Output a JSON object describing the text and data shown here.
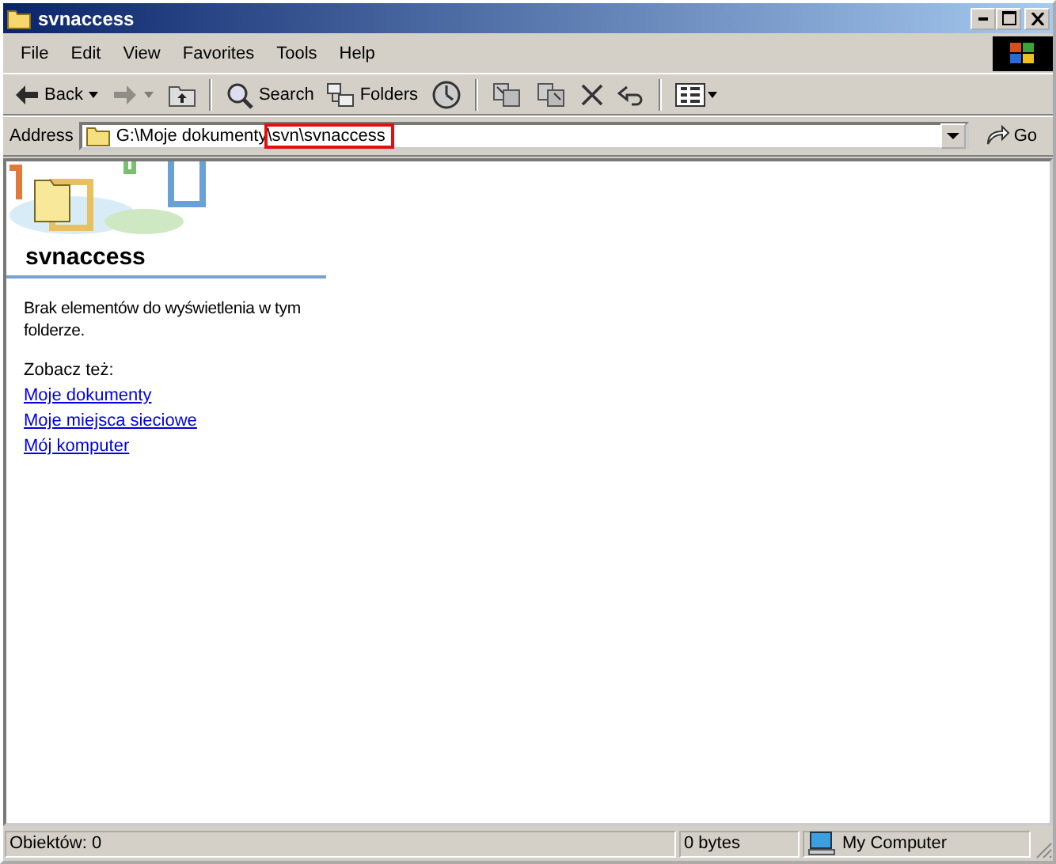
{
  "window": {
    "title": "svnaccess"
  },
  "menu": [
    "File",
    "Edit",
    "View",
    "Favorites",
    "Tools",
    "Help"
  ],
  "toolbar": [
    {
      "kind": "back",
      "label": "Back",
      "disabled": false
    },
    {
      "kind": "forward",
      "disabled": true
    },
    {
      "kind": "up",
      "disabled": false
    },
    {
      "kind": "separator"
    },
    {
      "kind": "search",
      "label": "Search",
      "disabled": false
    },
    {
      "kind": "folders",
      "label": "Folders",
      "disabled": false
    },
    {
      "kind": "history",
      "disabled": false
    },
    {
      "kind": "separator"
    },
    {
      "kind": "move",
      "disabled": false
    },
    {
      "kind": "copy",
      "disabled": false
    },
    {
      "kind": "delete",
      "disabled": false
    },
    {
      "kind": "undo",
      "disabled": false
    },
    {
      "kind": "separator"
    },
    {
      "kind": "views",
      "disabled": false
    }
  ],
  "address": {
    "label": "Address",
    "path": [
      {
        "text": "G:\\Moje dokumenty",
        "highlighted": false
      },
      {
        "text": "\\svn\\svnaccess",
        "highlighted": true
      }
    ],
    "go": "Go"
  },
  "panel": {
    "title": "svnaccess",
    "message": "Brak elementów do wyświetlenia w tym folderze.",
    "see_also": "Zobacz też:",
    "links": [
      "Moje dokumenty",
      "Moje miejsca sieciowe",
      "Mój komputer"
    ]
  },
  "status_bar": {
    "objects": "Obiektów: 0",
    "size": "0 bytes",
    "zone": "My Computer"
  }
}
